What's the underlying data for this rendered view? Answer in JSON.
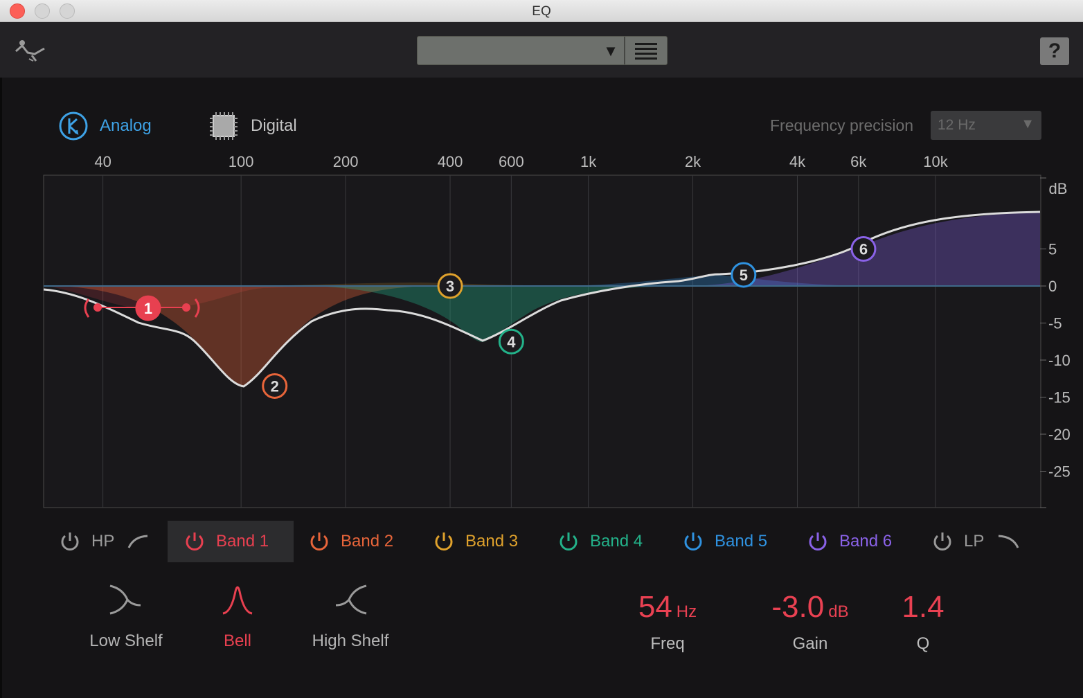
{
  "window": {
    "title": "EQ"
  },
  "toolbar": {
    "logo_icon": "eq-logo-icon",
    "help_label": "?"
  },
  "mode": {
    "analog_label": "Analog",
    "digital_label": "Digital",
    "selected": "Analog"
  },
  "frequency_precision": {
    "label": "Frequency precision",
    "value": "12 Hz"
  },
  "chart_data": {
    "type": "line",
    "x_scale": "log",
    "x_ticks": [
      "40",
      "100",
      "200",
      "400",
      "600",
      "1k",
      "2k",
      "4k",
      "6k",
      "10k"
    ],
    "y_ticks": [
      "5",
      "0",
      "-5",
      "-10",
      "-15",
      "-20",
      "-25"
    ],
    "y_unit": "dB",
    "bands": [
      {
        "id": "1",
        "name": "Band 1",
        "freq_hz": 54,
        "gain_db": -3.0,
        "q": 1.4,
        "color": "#e84050"
      },
      {
        "id": "2",
        "name": "Band 2",
        "freq_hz": 125,
        "gain_db": -13.5,
        "color": "#e8653a"
      },
      {
        "id": "3",
        "name": "Band 3",
        "freq_hz": 400,
        "gain_db": 0,
        "color": "#e0a22c"
      },
      {
        "id": "4",
        "name": "Band 4",
        "freq_hz": 600,
        "gain_db": -7.5,
        "color": "#23b28a"
      },
      {
        "id": "5",
        "name": "Band 5",
        "freq_hz": 2800,
        "gain_db": 1.5,
        "color": "#2f92e0"
      },
      {
        "id": "6",
        "name": "Band 6",
        "freq_hz": 6200,
        "gain_db": 5,
        "color": "#8a62e8"
      }
    ]
  },
  "bands_row": [
    {
      "label": "HP",
      "color": "#9a9a9a"
    },
    {
      "label": "Band 1",
      "color": "#e84050"
    },
    {
      "label": "Band 2",
      "color": "#e8653a"
    },
    {
      "label": "Band 3",
      "color": "#e0a22c"
    },
    {
      "label": "Band 4",
      "color": "#23b28a"
    },
    {
      "label": "Band 5",
      "color": "#2f92e0"
    },
    {
      "label": "Band 6",
      "color": "#8a62e8"
    },
    {
      "label": "LP",
      "color": "#9a9a9a"
    }
  ],
  "selected_band": "Band 1",
  "shapes": {
    "low_shelf": "Low Shelf",
    "bell": "Bell",
    "high_shelf": "High Shelf",
    "selected": "Bell"
  },
  "params": {
    "freq": {
      "value": "54",
      "unit": "Hz",
      "label": "Freq"
    },
    "gain": {
      "value": "-3.0",
      "unit": "dB",
      "label": "Gain"
    },
    "q": {
      "value": "1.4",
      "unit": "",
      "label": "Q"
    }
  }
}
